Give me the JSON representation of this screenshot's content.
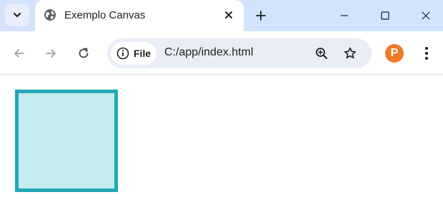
{
  "browser": {
    "tab": {
      "title": "Exemplo Canvas",
      "favicon": "globe-icon"
    },
    "address": {
      "chip_label": "File",
      "url": "C:/app/index.html"
    },
    "profile_letter": "P"
  },
  "canvas": {
    "shape": "square",
    "fill_color": "#c5ebee",
    "stroke_color": "#20a8b4"
  },
  "colors": {
    "tabbar_bg": "#d3e3fd",
    "omnibox_bg": "#e9eef6",
    "profile_bg": "#f07a28"
  }
}
